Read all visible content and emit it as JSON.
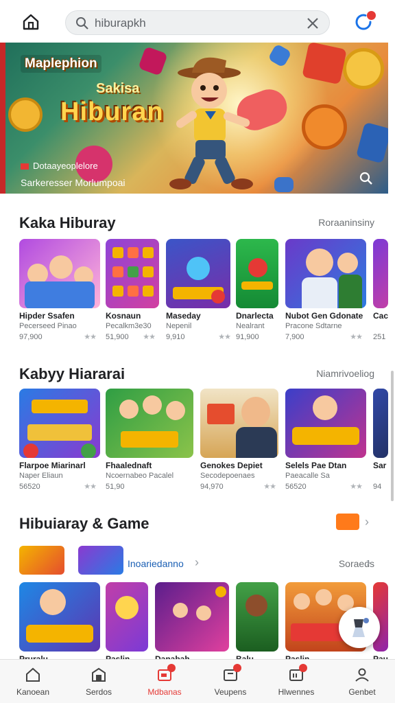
{
  "search": {
    "value": "hiburapkh"
  },
  "banner": {
    "tag": "Maplephion",
    "subtitle": "Sakisa",
    "title": "Hiburan",
    "caption1": "Dotaayeoplelore",
    "caption2": "Sarkeresser Morlumpoai"
  },
  "section1": {
    "title": "Kaka Hiburay",
    "more": "Roraaninsiny",
    "cards": [
      {
        "title": "Hipder Ssafen",
        "sub": "Pecerseed Pinao",
        "price": "97,900",
        "stars": "★★"
      },
      {
        "title": "Kosnaun",
        "sub": "Pecalkm3e30",
        "price": "51,900",
        "stars": "★★"
      },
      {
        "title": "Maseday",
        "sub": "Nepenil",
        "price": "9,910",
        "stars": "★★"
      },
      {
        "title": "Dnarlecta",
        "sub": "Nealrant",
        "price": "91,900",
        "stars": "★★"
      },
      {
        "title": "Nubot Gen Gdonate",
        "sub": "Pracone Sdtarne",
        "price": "7,900",
        "stars": "★★"
      },
      {
        "title": "Cac",
        "sub": "",
        "price": "251",
        "stars": ""
      }
    ]
  },
  "section2": {
    "title": "Kabyy Hiararai",
    "more": "Niamrivoeliog",
    "cards": [
      {
        "title": "Flarpoe Miarinarl",
        "sub": "Naper Eliaun",
        "price": "56520",
        "stars": "★★"
      },
      {
        "title": "Fhaalednaft",
        "sub": "Ncoernabeo Pacalel",
        "price": "51,90",
        "stars": "★★"
      },
      {
        "title": "Genokes Depiet",
        "sub": "Secodepoenaes",
        "price": "94,970",
        "stars": "★★"
      },
      {
        "title": "Selels Pae Dtan",
        "sub": "Paeacalle Sa",
        "price": "56520",
        "stars": "★★"
      },
      {
        "title": "Sar",
        "sub": "",
        "price": "94",
        "stars": ""
      }
    ]
  },
  "section3": {
    "title": "Hibuiaray & Game",
    "chip_label": "Inoariedanno",
    "right": "Soraeds",
    "cards": [
      "Pruralu",
      "Paslin",
      "Danabah",
      "Balu",
      "Paslin",
      "Pau"
    ]
  },
  "nav": [
    {
      "label": "Kanoean"
    },
    {
      "label": "Serdos"
    },
    {
      "label": "Mdbanas"
    },
    {
      "label": "Veupens"
    },
    {
      "label": "Hlwennes"
    },
    {
      "label": "Genbet"
    }
  ],
  "colors": {
    "accent": "#e53935",
    "link": "#1a5fb4"
  }
}
